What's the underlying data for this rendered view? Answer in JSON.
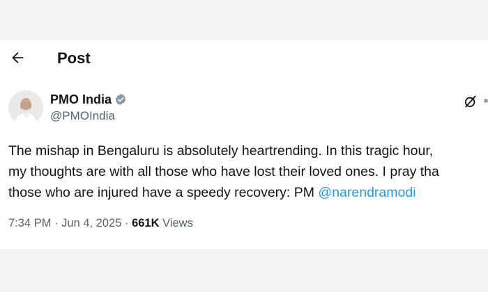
{
  "header": {
    "title": "Post",
    "back_icon": "arrow-left-icon"
  },
  "post": {
    "author": {
      "name": "PMO India",
      "handle": "@PMOIndia",
      "verified": true
    },
    "text_lines": [
      "The mishap in Bengaluru is absolutely heartrending. In this tragic hour,",
      "my thoughts are with all those who have lost their loved ones. I pray tha",
      "those who are injured have a speedy recovery: PM "
    ],
    "mention": "@narendramodi",
    "time": "7:34 PM",
    "date": "Jun 4, 2025",
    "separator": "·",
    "views_count": "661K",
    "views_label": "Views",
    "grok_icon": "grok-icon"
  },
  "colors": {
    "accent": "#1d9bf0",
    "secondary_text": "#536471",
    "text": "#0f1419"
  }
}
